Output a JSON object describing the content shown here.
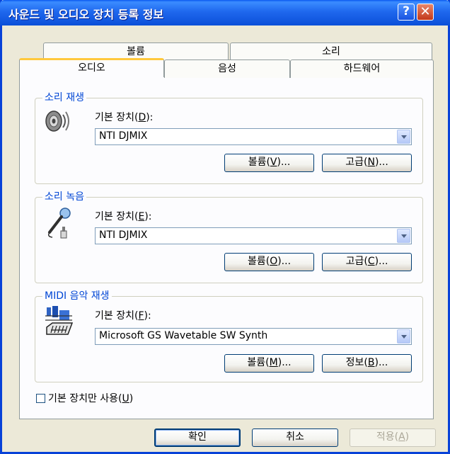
{
  "window": {
    "title": "사운드 및 오디오 장치 등록 정보"
  },
  "titlebar": {
    "help_glyph": "?",
    "close_glyph": "✕"
  },
  "tabs": {
    "row1": [
      {
        "label": "볼륨"
      },
      {
        "label": "소리"
      }
    ],
    "row2": [
      {
        "label": "오디오",
        "selected": true
      },
      {
        "label": "음성"
      },
      {
        "label": "하드웨어"
      }
    ]
  },
  "playback": {
    "group_label": "소리 재생",
    "device_label_pre": "기본 장치(",
    "device_label_key": "D",
    "device_label_post": "):",
    "device_value": "NTI DJMIX",
    "volume_pre": "볼륨(",
    "volume_key": "V",
    "volume_post": ")...",
    "advanced_pre": "고급(",
    "advanced_key": "N",
    "advanced_post": ")...",
    "icon": "speaker-icon"
  },
  "recording": {
    "group_label": "소리 녹음",
    "device_label_pre": "기본 장치(",
    "device_label_key": "E",
    "device_label_post": "):",
    "device_value": "NTI DJMIX",
    "volume_pre": "볼륨(",
    "volume_key": "O",
    "volume_post": ")...",
    "advanced_pre": "고급(",
    "advanced_key": "C",
    "advanced_post": ")...",
    "icon": "microphone-icon"
  },
  "midi": {
    "group_label": "MIDI 음악 재생",
    "device_label_pre": "기본 장치(",
    "device_label_key": "F",
    "device_label_post": "):",
    "device_value": "Microsoft GS Wavetable SW Synth",
    "volume_pre": "볼륨(",
    "volume_key": "M",
    "volume_post": ")...",
    "about_pre": "정보(",
    "about_key": "B",
    "about_post": ")...",
    "icon": "midi-keyboard-icon"
  },
  "default_only": {
    "label_pre": "기본 장치만 사용(",
    "label_key": "U",
    "label_post": ")",
    "checked": false
  },
  "footer": {
    "ok": "확인",
    "cancel": "취소",
    "apply_pre": "적용(",
    "apply_key": "A",
    "apply_post": ")",
    "apply_enabled": false
  },
  "colors": {
    "titlebar": "#0b4fd8",
    "group_label": "#0046d5",
    "face": "#ece9d8",
    "tab_highlight": "#ffc83c"
  }
}
